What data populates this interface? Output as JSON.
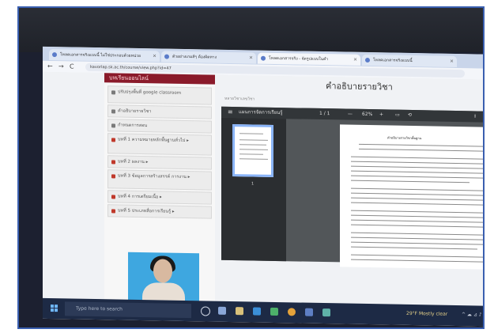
{
  "browser": {
    "tabs": [
      {
        "label": "โหลดเอกสารจริงแบบนี้ ไม่ใช่ประกอบด้วยหน่วย"
      },
      {
        "label": "ตัวอย่างเกมส์ๆ ต้องผิดทาง"
      },
      {
        "label": "โหลดเอกสารจริง - จัดรูปแบบในคำ"
      },
      {
        "label": "โหลดเอกสารจริงแบบนี้"
      }
    ],
    "back": "←",
    "forward": "→",
    "reload": "C",
    "url": "kavorlap.sk.ac.th/course/view.php?id=47"
  },
  "sidebar": {
    "header": "บทเรียนออนไลน์",
    "items": [
      {
        "label": "ปรับปรุงพื้นที่ google classroom",
        "kind": "pen"
      },
      {
        "label": "คำอธิบายรายวิชา",
        "kind": "pen"
      },
      {
        "label": "กำหนดการสอน",
        "kind": "pen"
      },
      {
        "label": "บทที่ 1 ความหมายหลักพื้นฐานทั่วไป ▸",
        "kind": "sq"
      },
      {
        "label": "บทที่ 2 ผลงาน ▸",
        "kind": "sq"
      },
      {
        "label": "บทที่ 3 ข้อมูลการสร้างสรรค์ การงาน ▸",
        "kind": "sq"
      },
      {
        "label": "บทที่ 4 การเตรียมเนื้อ ▸",
        "kind": "sq"
      },
      {
        "label": "บทที่ 5 ประเภทสื่อการเรียนรู้ ▸",
        "kind": "sq"
      }
    ]
  },
  "main": {
    "page_title": "คำอธิบายรายวิชา",
    "breadcrumb": "หลายวิชาเลขวิชา",
    "viewer": {
      "menu": "≡",
      "file": "แผนการจัดการเรียนรู้",
      "pages": "1 / 1",
      "minus": "—",
      "zoom": "62%",
      "plus": "+",
      "thumb_number": "1",
      "doc_title": "คำอธิบายรายวิชาพื้นฐาน"
    }
  },
  "taskbar": {
    "search_placeholder": "Type here to search",
    "weather": "29°F Mostly clear",
    "tray": "^ ☁ ⊿ ♪"
  },
  "colors": {
    "sidebar_header": "#8a1a2a",
    "accent": "#8ab4f8",
    "taskbar": "#1d2a45"
  }
}
